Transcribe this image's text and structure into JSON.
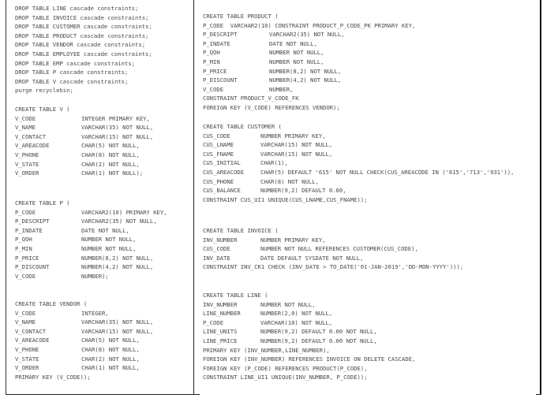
{
  "left_column": {
    "drop_statements": [
      "DROP TABLE LINE cascade constraints;",
      "DROP TABLE INVOICE cascade constraints;",
      "DROP TABLE CUSTOMER cascade constraints;",
      "DROP TABLE PRODUCT cascade constraints;",
      "DROP TABLE VENDOR cascade constraints;",
      "DROP TABLE EMPLOYEE cascade constraints;",
      "DROP TABLE EMP cascade constraints;",
      "DROP TABLE P cascade constraints;",
      "DROP TABLE V cascade constraints;",
      "purge recyclebin;"
    ],
    "table_v": {
      "header": "CREATE TABLE V (",
      "rows": [
        {
          "col": "V_CODE",
          "def": "INTEGER PRIMARY KEY,"
        },
        {
          "col": "V_NAME",
          "def": "VARCHAR(35) NOT NULL,"
        },
        {
          "col": "V_CONTACT",
          "def": "VARCHAR(15) NOT NULL,"
        },
        {
          "col": "V_AREACODE",
          "def": "CHAR(5) NOT NULL,"
        },
        {
          "col": "V_PHONE",
          "def": "CHAR(8) NOT NULL,"
        },
        {
          "col": "V_STATE",
          "def": "CHAR(2) NOT NULL,"
        },
        {
          "col": "V_ORDER",
          "def": "CHAR(1) NOT NULL);"
        }
      ]
    },
    "table_p": {
      "header": "CREATE TABLE P (",
      "rows": [
        {
          "col": "P_CODE",
          "def": "VARCHAR2(10) PRIMARY KEY,"
        },
        {
          "col": "P_DESCRIPT",
          "def": "VARCHAR2(35) NOT NULL,"
        },
        {
          "col": "P_INDATE",
          "def": "DATE NOT NULL,"
        },
        {
          "col": "P_QOH",
          "def": "NUMBER NOT NULL,"
        },
        {
          "col": "P_MIN",
          "def": "NUMBER NOT NULL,"
        },
        {
          "col": "P_PRICE",
          "def": "NUMBER(8,2) NOT NULL,"
        },
        {
          "col": "P_DISCOUNT",
          "def": "NUMBER(4,2) NOT NULL,"
        },
        {
          "col": "V_CODE",
          "def": "NUMBER);"
        }
      ]
    },
    "table_vendor": {
      "header": "CREATE TABLE VENDOR (",
      "rows": [
        {
          "col": "V_CODE",
          "def": "INTEGER,"
        },
        {
          "col": "V_NAME",
          "def": "VARCHAR(35) NOT NULL,"
        },
        {
          "col": "V_CONTACT",
          "def": "VARCHAR(15) NOT NULL,"
        },
        {
          "col": "V_AREACODE",
          "def": "CHAR(5) NOT NULL,"
        },
        {
          "col": "V_PHONE",
          "def": "CHAR(8) NOT NULL,"
        },
        {
          "col": "V_STATE",
          "def": "CHAR(2) NOT NULL,"
        },
        {
          "col": "V_ORDER",
          "def": "CHAR(1) NOT NULL,"
        }
      ],
      "footer": "PRIMARY KEY (V_CODE));"
    }
  },
  "right_column": {
    "table_product": {
      "header": "CREATE TABLE PRODUCT (",
      "first_line": "P_CODE  VARCHAR2(10) CONSTRAINT PRODUCT_P_CODE_PK PRIMARY KEY,",
      "rows": [
        {
          "col": "P_DESCRIPT",
          "def": "VARCHAR2(35) NOT NULL,"
        },
        {
          "col": "P_INDATE",
          "def": "DATE NOT NULL,"
        },
        {
          "col": "P_QOH",
          "def": "NUMBER NOT NULL,"
        },
        {
          "col": "P_MIN",
          "def": "NUMBER NOT NULL,"
        },
        {
          "col": "P_PRICE",
          "def": "NUMBER(8,2) NOT NULL,"
        },
        {
          "col": "P_DISCOUNT",
          "def": "NUMBER(4,2) NOT NULL,"
        },
        {
          "col": "V_CODE",
          "def": "NUMBER,"
        }
      ],
      "footer": [
        "CONSTRAINT PRODUCT_V_CODE_FK",
        "FOREIGN KEY (V_CODE) REFERENCES VENDOR);"
      ]
    },
    "table_customer": {
      "header": "CREATE TABLE CUSTOMER (",
      "rows": [
        {
          "col": "CUS_CODE",
          "def": "NUMBER PRIMARY KEY,"
        },
        {
          "col": "CUS_LNAME",
          "def": "VARCHAR(15) NOT NULL,"
        },
        {
          "col": "CUS_FNAME",
          "def": "VARCHAR(15) NOT NULL,"
        },
        {
          "col": "CUS_INITIAL",
          "def": "CHAR(1),"
        },
        {
          "col": "CUS_AREACODE",
          "def": "CHAR(5) DEFAULT '615' NOT NULL CHECK(CUS_AREACODE IN ('615','713','931')),"
        },
        {
          "col": "CUS_PHONE",
          "def": "CHAR(8) NOT NULL,"
        },
        {
          "col": "CUS_BALANCE",
          "def": "NUMBER(9,2) DEFAULT 0.00,"
        }
      ],
      "footer": [
        "CONSTRAINT CUS_UI1 UNIQUE(CUS_LNAME,CUS_FNAME));"
      ]
    },
    "table_invoice": {
      "header": "CREATE TABLE INVOICE (",
      "rows": [
        {
          "col": "INV_NUMBER",
          "def": "NUMBER PRIMARY KEY,"
        },
        {
          "col": "CUS_CODE",
          "def": "NUMBER NOT NULL REFERENCES CUSTOMER(CUS_CODE),"
        },
        {
          "col": "INV_DATE",
          "def": "DATE DEFAULT SYSDATE NOT NULL,"
        }
      ],
      "footer": [
        "CONSTRAINT INV_CK1 CHECK (INV_DATE > TO_DATE('01-JAN-2019','DD-MON-YYYY')));"
      ]
    },
    "table_line": {
      "header": "CREATE TABLE LINE (",
      "rows": [
        {
          "col": "INV_NUMBER",
          "def": "NUMBER NOT NULL,"
        },
        {
          "col": "LINE_NUMBER",
          "def": "NUMBER(2,0) NOT NULL,"
        },
        {
          "col": "P_CODE",
          "def": "VARCHAR(10) NOT NULL,"
        },
        {
          "col": "LINE_UNITS",
          "def": "NUMBER(9,2) DEFAULT 0.00 NOT NULL,"
        },
        {
          "col": "LINE_PRICE",
          "def": "NUMBER(9,2) DEFAULT 0.00 NOT NULL,"
        }
      ],
      "footer": [
        "PRIMARY KEY (INV_NUMBER,LINE_NUMBER),",
        "FOREIGN KEY (INV_NUMBER) REFERENCES INVOICE ON DELETE CASCADE,",
        "FOREIGN KEY (P_CODE) REFERENCES PRODUCT(P_CODE),",
        "CONSTRAINT LINE_UI1 UNIQUE(INV_NUMBER, P_CODE));"
      ]
    }
  }
}
